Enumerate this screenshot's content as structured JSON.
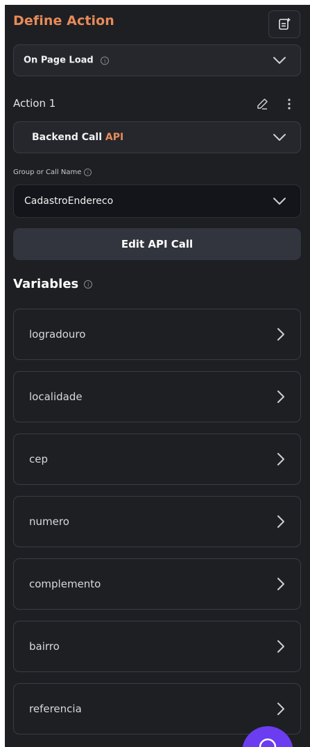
{
  "panel": {
    "title": "Define Action"
  },
  "trigger": {
    "label": "On Page Load",
    "info_icon": "info-icon"
  },
  "action": {
    "label": "Action 1",
    "type_label": "Backend Call",
    "type_tag": "API"
  },
  "api_call": {
    "group_label": "Group or Call Name",
    "selected_call": "CadastroEndereco",
    "edit_button_label": "Edit API Call"
  },
  "variables": {
    "heading": "Variables",
    "items": [
      {
        "label": "logradouro"
      },
      {
        "label": "localidade"
      },
      {
        "label": "cep"
      },
      {
        "label": "numero"
      },
      {
        "label": "complemento"
      },
      {
        "label": "bairro"
      },
      {
        "label": "referencia"
      }
    ]
  },
  "colors": {
    "panel_bg": "#1d1f23",
    "accent_orange": "#e88b58",
    "fab_purple": "#6c3cf0",
    "border": "#3a3d45"
  }
}
